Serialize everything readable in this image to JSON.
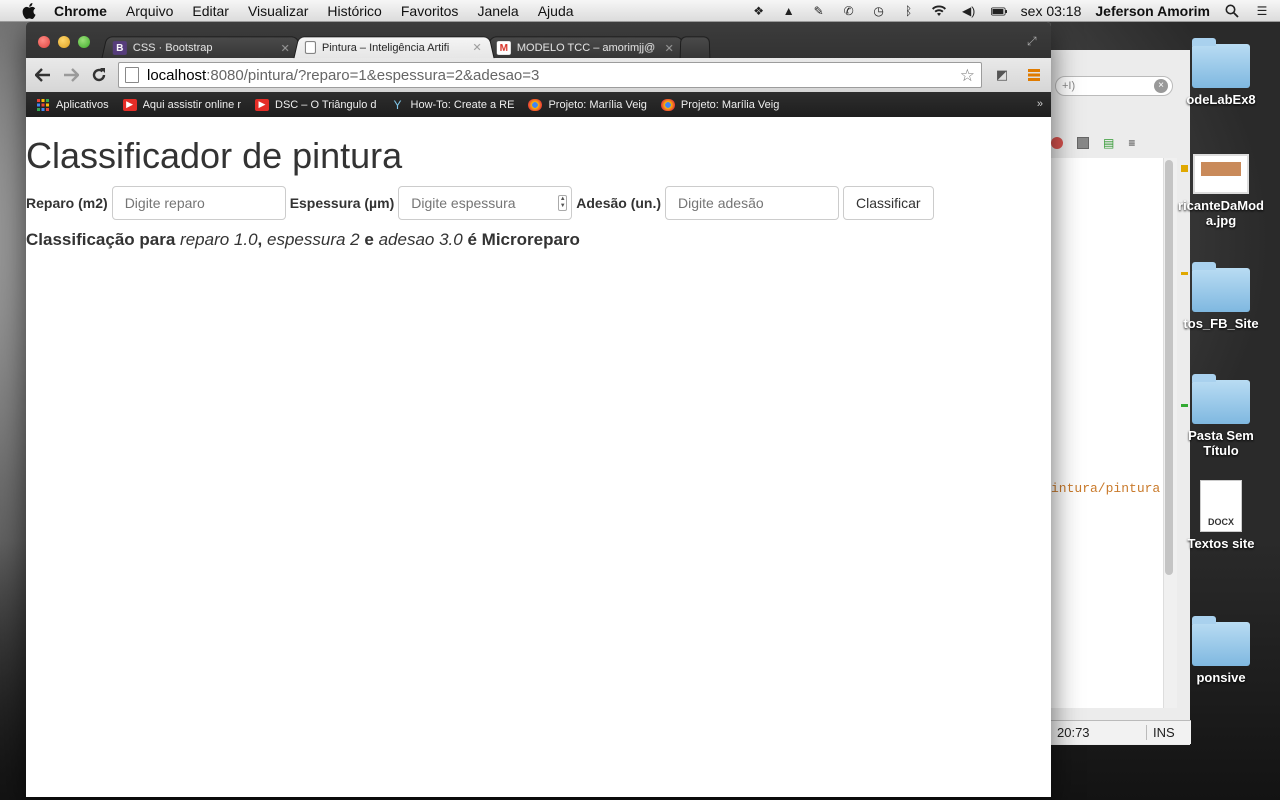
{
  "menubar": {
    "items": [
      "Chrome",
      "Arquivo",
      "Editar",
      "Visualizar",
      "Histórico",
      "Favoritos",
      "Janela",
      "Ajuda"
    ],
    "clock": "sex 03:18",
    "user": "Jeferson Amorim"
  },
  "browser": {
    "tabs": [
      {
        "title": "CSS · Bootstrap",
        "favicon": "B"
      },
      {
        "title": "Pintura – Inteligência Artifi",
        "favicon": "page"
      },
      {
        "title": "MODELO TCC – amorimjj@",
        "favicon": "M"
      }
    ],
    "url": {
      "host": "localhost",
      "rest": ":8080/pintura/?reparo=1&espessura=2&adesao=3"
    },
    "bookmarks": [
      {
        "label": "Aplicativos",
        "icon": "apps-icon"
      },
      {
        "label": "Aqui assistir online r",
        "icon": "youtube-icon"
      },
      {
        "label": "DSC – O Triângulo d",
        "icon": "youtube-icon"
      },
      {
        "label": "How-To: Create a RE",
        "icon": "yeoman-icon"
      },
      {
        "label": "Projeto: Marília Veig",
        "icon": "chrome-icon"
      },
      {
        "label": "Projeto: Marília Veig",
        "icon": "chrome-icon"
      }
    ],
    "bookmarks_more": "»"
  },
  "page": {
    "title": "Classificador de pintura",
    "form": {
      "reparo_label": "Reparo (m2)",
      "reparo_placeholder": "Digite reparo",
      "espessura_label": "Espessura (µm)",
      "espessura_placeholder": "Digite espessura",
      "adesao_label": "Adesão (un.)",
      "adesao_placeholder": "Digite adesão",
      "submit_label": "Classificar"
    },
    "result": {
      "prefix": "Classificação para",
      "reparo_text": "reparo 1.0",
      "sep1": ",",
      "espessura_text": "espessura 2",
      "conj": "e",
      "adesao_text": "adesao 3.0",
      "verb": "é",
      "classification": "Microreparo"
    }
  },
  "background_editor": {
    "search_fragment": "+I)",
    "code_fragment": "intura/pintura",
    "status_position": "20:73",
    "status_mode": "INS"
  },
  "desktop_icons": [
    {
      "label": "odeLabEx8",
      "type": "folder"
    },
    {
      "label": "ricanteDaModa.jpg",
      "type": "image"
    },
    {
      "label": "tos_FB_Site",
      "type": "folder"
    },
    {
      "label": "Pasta Sem Título",
      "type": "folder"
    },
    {
      "label": "Textos site",
      "type": "docx",
      "badge": "DOCX"
    },
    {
      "label": "ponsive",
      "type": "folder"
    }
  ]
}
